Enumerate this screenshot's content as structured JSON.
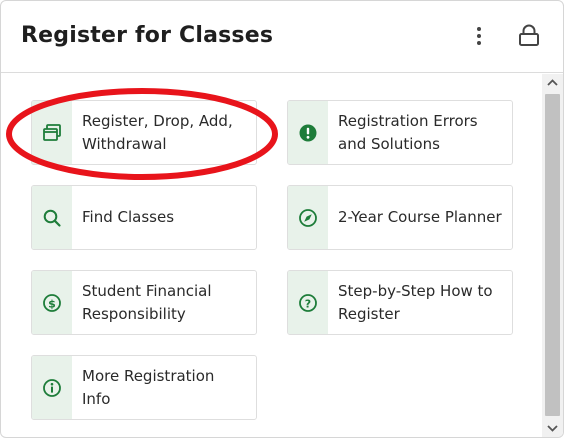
{
  "header": {
    "title": "Register for Classes",
    "more_icon": "kebab-vertical-icon",
    "lock_icon": "lock-icon"
  },
  "tiles": [
    {
      "label_line1": "Register, Drop, Add,",
      "label_line2": "Withdrawal",
      "icon": "window-stack-icon"
    },
    {
      "label_line1": "Registration Errors",
      "label_line2": "and Solutions",
      "icon": "exclamation-circle-icon"
    },
    {
      "label_line1": "Find Classes",
      "label_line2": "",
      "icon": "search-icon"
    },
    {
      "label_line1": "2-Year Course Planner",
      "label_line2": "",
      "icon": "compass-icon"
    },
    {
      "label_line1": "Student Financial",
      "label_line2": "Responsibility",
      "icon": "dollar-circle-icon"
    },
    {
      "label_line1": "Step-by-Step How to",
      "label_line2": "Register",
      "icon": "question-circle-icon"
    },
    {
      "label_line1": "More Registration",
      "label_line2": "Info",
      "icon": "info-circle-icon"
    }
  ],
  "colors": {
    "accent_green": "#1e7d3a",
    "icon_bg": "#e8f2ea",
    "annotation_red": "#e8141b"
  }
}
